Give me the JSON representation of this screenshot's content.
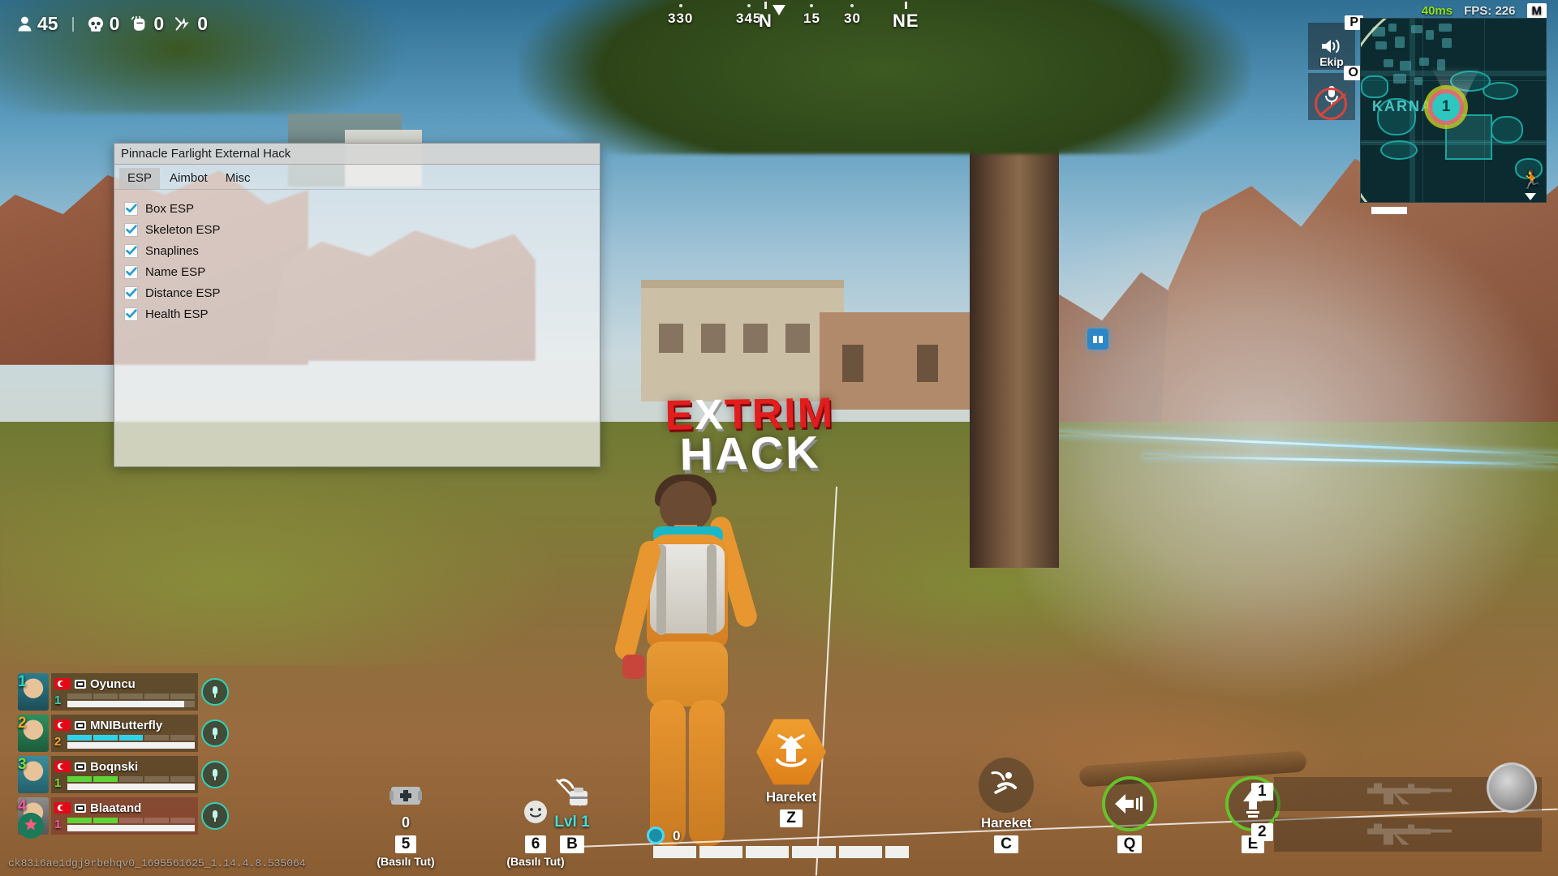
{
  "hud": {
    "stats": [
      {
        "icon": "player-count-icon",
        "value": "45"
      },
      {
        "icon": "skull-kills-icon",
        "value": "0"
      },
      {
        "icon": "knockdown-fist-icon",
        "value": "0"
      },
      {
        "icon": "damage-bolt-icon",
        "value": "0"
      }
    ],
    "performance": {
      "ping": "40ms",
      "fps": "FPS: 226",
      "network_badge": "M",
      "ping_color": "#8ee020"
    },
    "compass": {
      "ticks": [
        {
          "label": "330",
          "type": "minor",
          "pos": 823
        },
        {
          "label": "345",
          "type": "minor",
          "pos": 907
        },
        {
          "label": "N",
          "type": "major",
          "pos": 935
        },
        {
          "label": "15",
          "type": "minor",
          "pos": 990
        },
        {
          "label": "30",
          "type": "minor",
          "pos": 1040
        },
        {
          "label": "NE",
          "type": "major",
          "pos": 1100
        }
      ]
    },
    "minimap": {
      "area_label": "KARNA",
      "player_marker": "1",
      "run_icon": "running-man-icon"
    },
    "voice": {
      "team_button": {
        "key": "P",
        "label": "Ekip",
        "icon": "speaker-icon"
      },
      "mic_button": {
        "key": "O",
        "label": "",
        "icon": "microphone-muted-icon"
      }
    },
    "squad": [
      {
        "slot": "1",
        "name": "Oyuncu",
        "level": "1",
        "flag": "turkey-flag",
        "shield_segments": 0,
        "shield_color": "",
        "hp_percent": 92,
        "downed": false
      },
      {
        "slot": "2",
        "name": "MNIButterfly",
        "level": "2",
        "flag": "turkey-flag",
        "shield_segments": 3,
        "shield_color": "#2fd3e8",
        "hp_percent": 100,
        "downed": false
      },
      {
        "slot": "3",
        "name": "Boqnski",
        "level": "1",
        "flag": "turkey-flag",
        "shield_segments": 2,
        "shield_color": "#5fd437",
        "hp_percent": 100,
        "downed": false
      },
      {
        "slot": "4",
        "name": "Blaatand",
        "level": "1",
        "flag": "turkey-flag",
        "shield_segments": 2,
        "shield_color": "#5fd437",
        "hp_percent": 100,
        "downed": true
      }
    ],
    "items": [
      {
        "name": "medkit-slot",
        "icon": "medkit-icon",
        "count": "0",
        "key": "5",
        "hint": "(Basılı Tut)"
      },
      {
        "name": "emote-slot",
        "icon": "emote-smiley-icon",
        "count": "",
        "key": "6",
        "hint": "(Basılı Tut)"
      }
    ],
    "backpack": {
      "icon": "backpack-icon",
      "level_label": "Lvl 1",
      "key": "B"
    },
    "action_button": {
      "label": "Hareket",
      "key": "Z",
      "icon": "up-arrow-boost-icon"
    },
    "round_buttons": [
      {
        "name": "hareket-c-button",
        "icon": "slide-move-icon",
        "label": "Hareket",
        "key": "C",
        "ring": false
      },
      {
        "name": "back-dash-button",
        "icon": "left-arrow-icon",
        "label": "",
        "key": "Q",
        "ring": true
      },
      {
        "name": "forward-boost-button",
        "icon": "up-arrow-icon",
        "label": "",
        "key": "E",
        "ring": true
      }
    ],
    "weapons": [
      {
        "key": "1",
        "icon": "rifle-silhouette-icon",
        "name": ""
      },
      {
        "key": "2",
        "icon": "rifle-silhouette-icon",
        "name": ""
      }
    ],
    "health": {
      "count": "0",
      "segments": 6,
      "fill_percent": 100
    },
    "watermark": "ck83i6ae1dgj9rbehqv0_1695561625_1.14.4.8.535064"
  },
  "hack_watermark": {
    "line1_prefix": "E",
    "line1_x": "X",
    "line1_suffix": "TRIM",
    "line2": "HACK",
    "red": "#e21d1d",
    "white": "#ffffff"
  },
  "cheat_window": {
    "title": "Pinnacle Farlight External Hack",
    "tabs": [
      {
        "label": "ESP",
        "active": true
      },
      {
        "label": "Aimbot",
        "active": false
      },
      {
        "label": "Misc",
        "active": false
      }
    ],
    "options": [
      {
        "label": "Box ESP",
        "checked": true
      },
      {
        "label": "Skeleton ESP",
        "checked": true
      },
      {
        "label": "Snaplines",
        "checked": true
      },
      {
        "label": "Name ESP",
        "checked": true
      },
      {
        "label": "Distance ESP",
        "checked": true
      },
      {
        "label": "Health ESP",
        "checked": true
      }
    ],
    "accent_color": "#1f9bd8"
  }
}
